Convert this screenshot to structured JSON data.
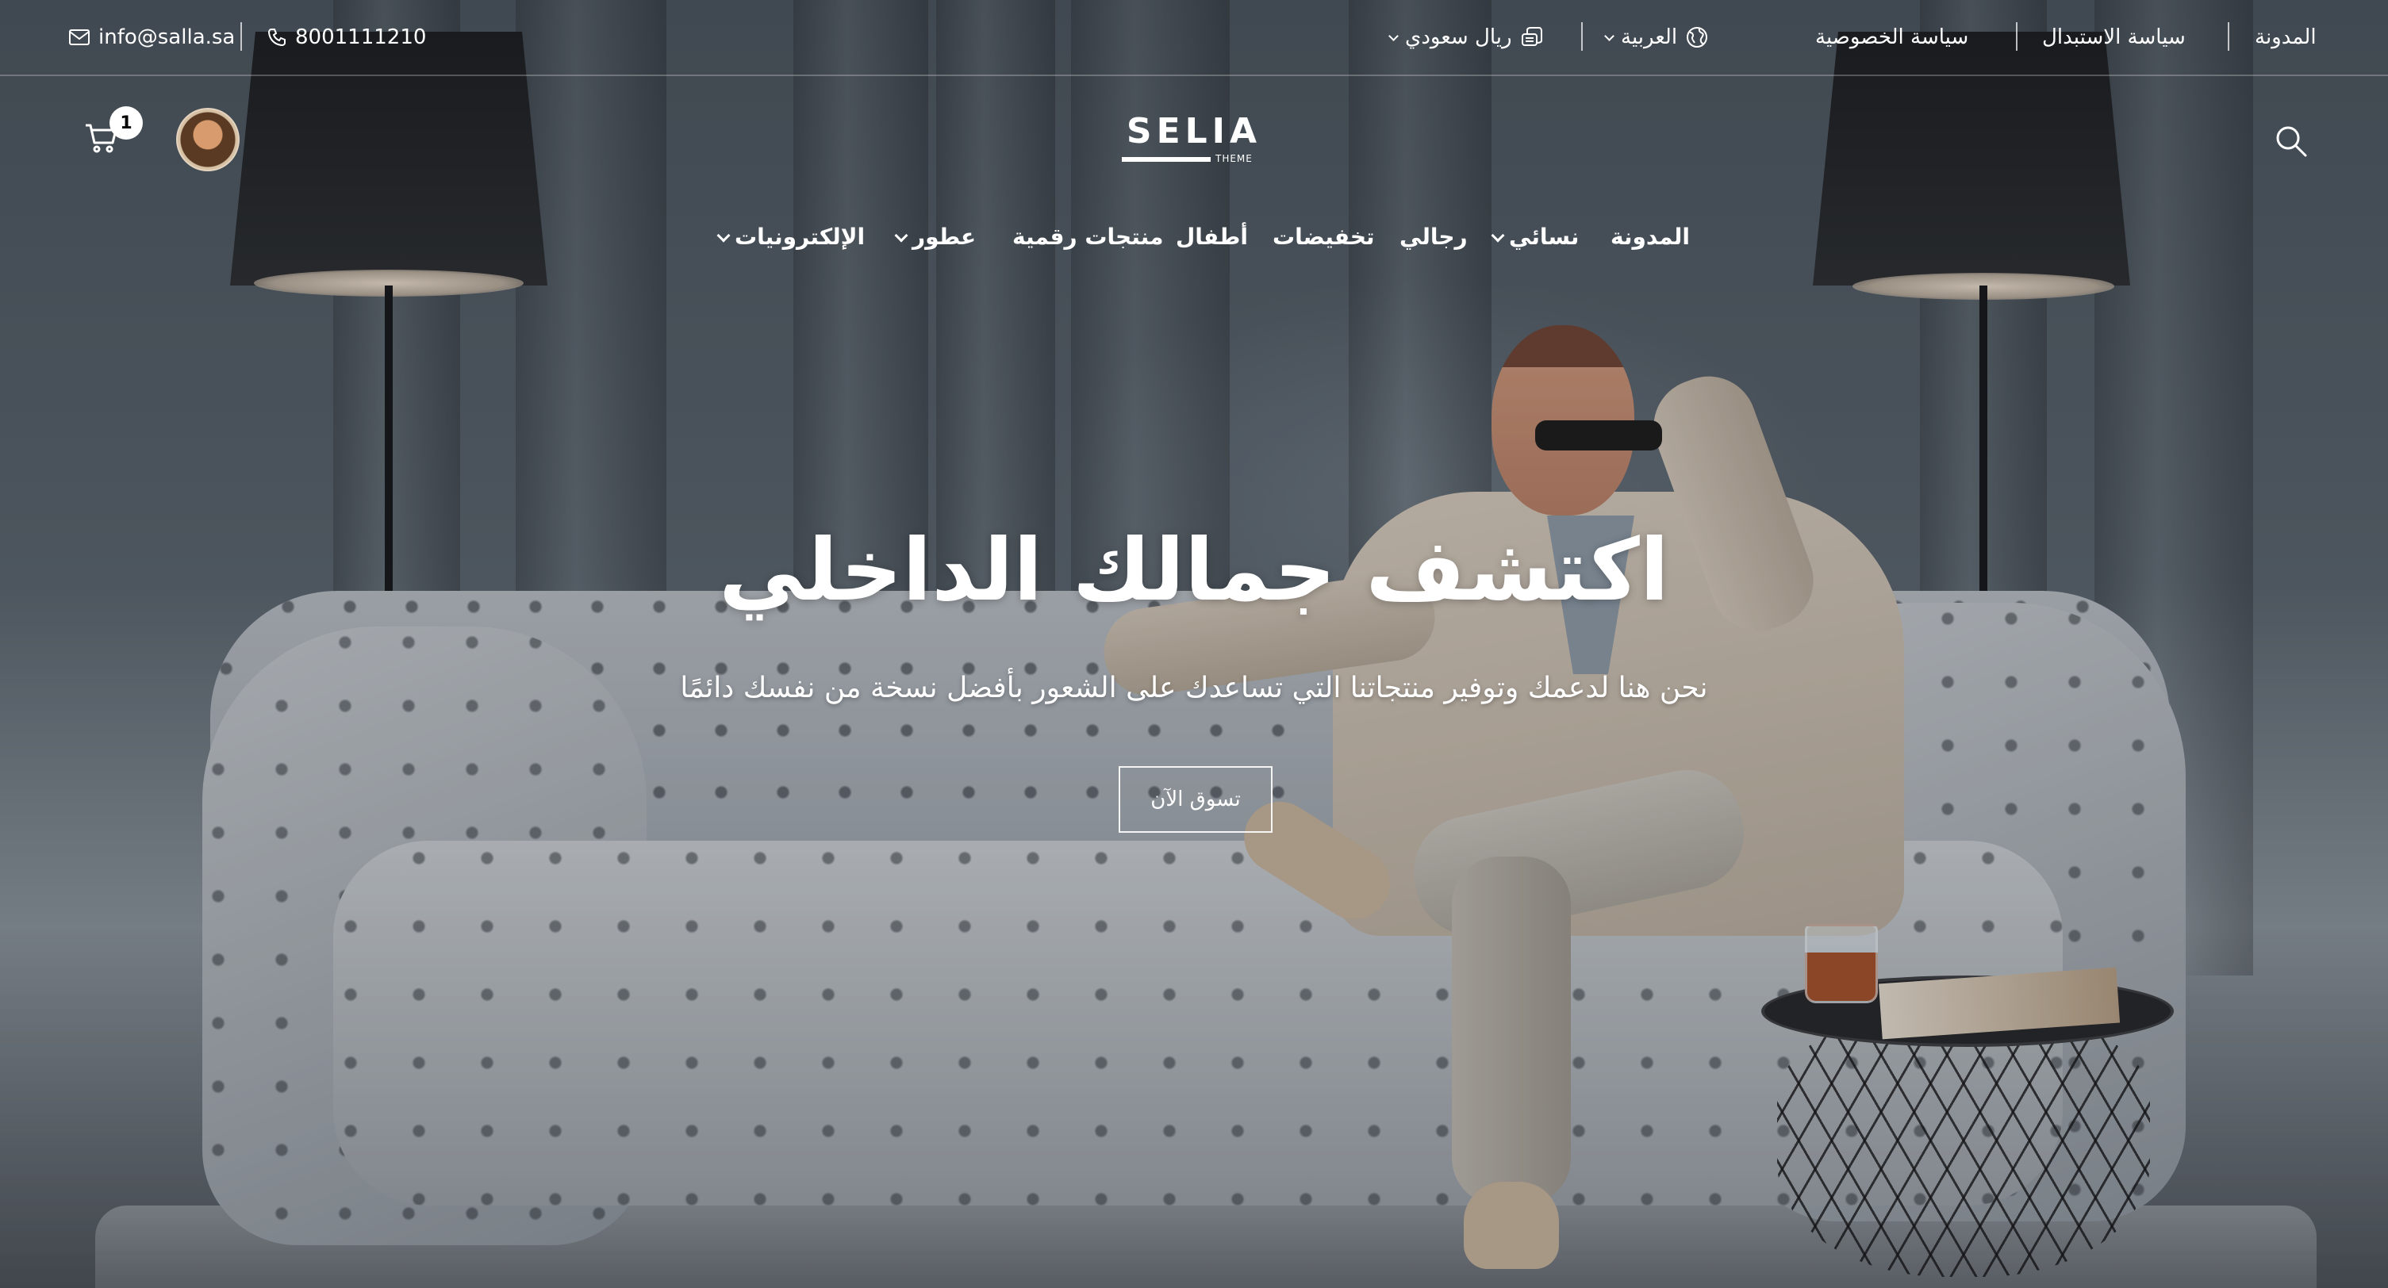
{
  "topbar": {
    "email": "info@salla.sa",
    "phone": "8001111210",
    "currency": "ريال سعودي",
    "language": "العربية",
    "links": [
      "سياسة الخصوصية",
      "سياسة الاستبدال",
      "المدونة"
    ]
  },
  "header": {
    "logo_text": "SELIA",
    "logo_sub": "THEME",
    "cart_count": "1"
  },
  "nav": {
    "items": [
      {
        "label": "المدونة",
        "has_dropdown": false
      },
      {
        "label": "نسائي",
        "has_dropdown": true
      },
      {
        "label": "رجالي",
        "has_dropdown": false
      },
      {
        "label": "تخفيضات",
        "has_dropdown": false
      },
      {
        "label": "أطفال",
        "has_dropdown": false
      },
      {
        "label": "منتجات رقمية",
        "has_dropdown": false
      },
      {
        "label": "عطور",
        "has_dropdown": true
      },
      {
        "label": "الإلكترونيات",
        "has_dropdown": true
      }
    ]
  },
  "hero": {
    "title": "اكتشف جمالك الداخلي",
    "subtitle": "نحن هنا لدعمك وتوفير منتجاتنا التي تساعدك على الشعور بأفضل نسخة من نفسك دائمًا",
    "cta_label": "تسوق الآن"
  },
  "icons": {
    "email": "mail-icon",
    "phone": "phone-icon",
    "currency": "coins-icon",
    "language": "globe-icon",
    "search": "search-icon",
    "cart": "cart-icon"
  },
  "colors": {
    "text": "#ffffff",
    "badge_bg": "#ffffff",
    "badge_text": "#000000"
  }
}
